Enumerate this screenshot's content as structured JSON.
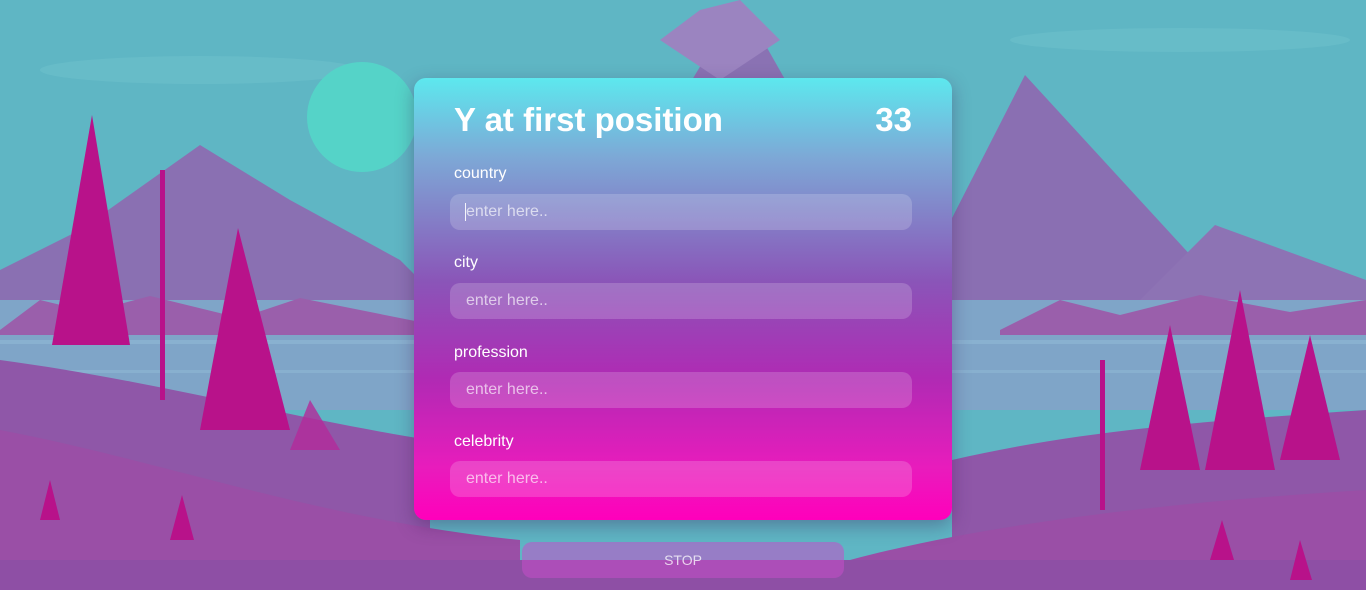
{
  "game": {
    "title": "Y at first position",
    "timer": "33"
  },
  "fields": [
    {
      "label": "country",
      "placeholder": "enter here..",
      "value": ""
    },
    {
      "label": "city",
      "placeholder": "enter here..",
      "value": ""
    },
    {
      "label": "profession",
      "placeholder": "enter here..",
      "value": ""
    },
    {
      "label": "celebrity",
      "placeholder": "enter here..",
      "value": ""
    }
  ],
  "actions": {
    "stop_label": "STOP"
  },
  "colors": {
    "sky": "#5fb6c4",
    "mountain": "#8e6fb0",
    "tree": "#b8128a",
    "sun": "#55d3c8",
    "card_top": "#5de8ee",
    "card_bottom": "#ff00bb"
  }
}
